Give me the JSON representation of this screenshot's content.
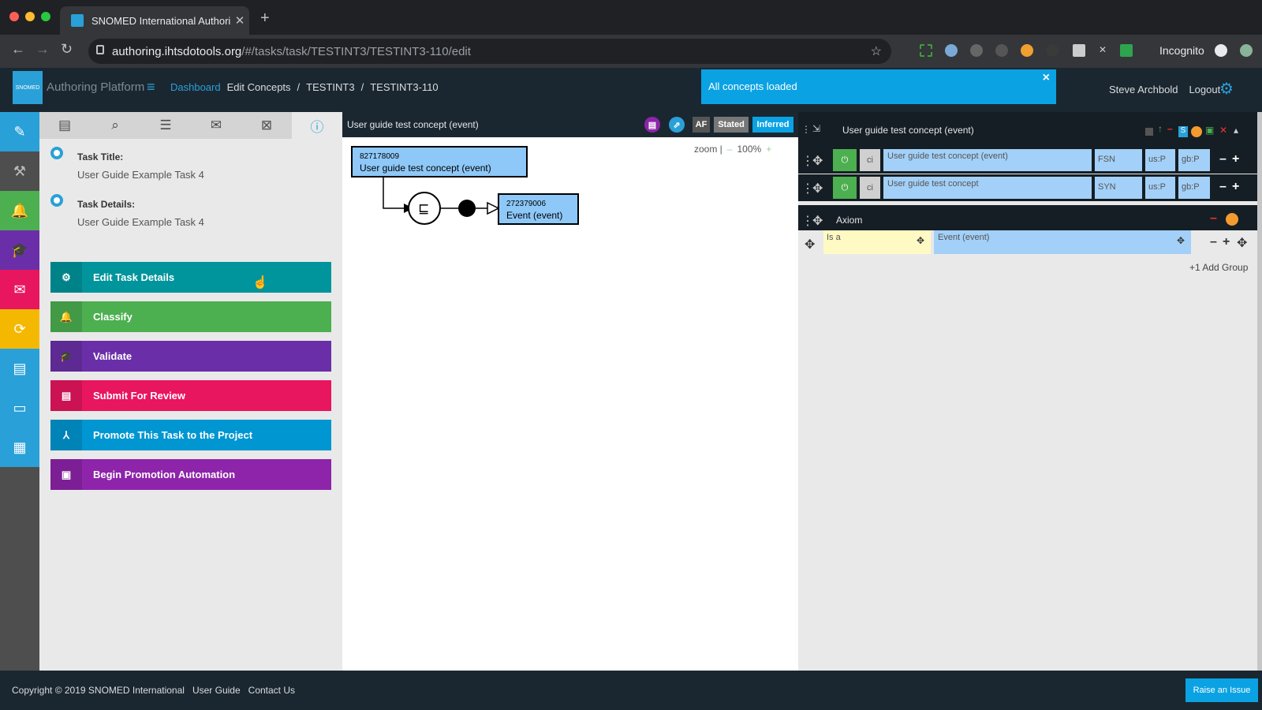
{
  "browser": {
    "tab_title": "SNOMED International Authorin",
    "url_host": "authoring.ihtsdotools.org",
    "url_path": "/#/tasks/task/TESTINT3/TESTINT3-110/edit",
    "incognito_label": "Incognito"
  },
  "header": {
    "brand": "Authoring Platform",
    "logo_text": "SNOMED",
    "breadcrumbs": {
      "dashboard": "Dashboard",
      "edit_concepts": "Edit Concepts",
      "sep1": "/",
      "project": "TESTINT3",
      "sep2": "/",
      "task": "TESTINT3-110"
    },
    "toast": "All concepts loaded",
    "user": "Steve Archbold",
    "logout": "Logout"
  },
  "task": {
    "title_label": "Task Title:",
    "title_value": "User Guide Example Task 4",
    "details_label": "Task Details:",
    "details_value": "User Guide Example Task 4",
    "actions": [
      {
        "label": "Edit Task Details",
        "color": "#00949c"
      },
      {
        "label": "Classify",
        "color": "#4caf50"
      },
      {
        "label": "Validate",
        "color": "#6a2fa8"
      },
      {
        "label": "Submit For Review",
        "color": "#e8155f"
      },
      {
        "label": "Promote This Task to the Project",
        "color": "#0096d1"
      },
      {
        "label": "Begin Promotion Automation",
        "color": "#8e24aa"
      }
    ]
  },
  "canvas": {
    "title": "User guide test concept (event)",
    "chips": {
      "af": "AF",
      "stated": "Stated",
      "inferred": "Inferred"
    },
    "zoom_label": "zoom |",
    "zoom_minus": "–",
    "zoom_value": "100%",
    "zoom_plus": "+",
    "concept_id": "827178009",
    "concept_name": "User guide test concept (event)",
    "parent_id": "272379006",
    "parent_name": "Event (event)"
  },
  "detail": {
    "title": "User guide test concept (event)",
    "descriptions": [
      {
        "case": "ci",
        "term": "User guide test concept (event)",
        "type": "FSN",
        "us": "us:P",
        "gb": "gb:P"
      },
      {
        "case": "ci",
        "term": "User guide test concept",
        "type": "SYN",
        "us": "us:P",
        "gb": "gb:P"
      }
    ],
    "axiom_label": "Axiom",
    "attr_type": "Is a",
    "attr_target": "Event (event)",
    "add_group": "+1 Add Group"
  },
  "footer": {
    "copyright": "Copyright © 2019 SNOMED International",
    "user_guide": "User Guide",
    "contact": "Contact Us",
    "raise": "Raise an Issue"
  }
}
